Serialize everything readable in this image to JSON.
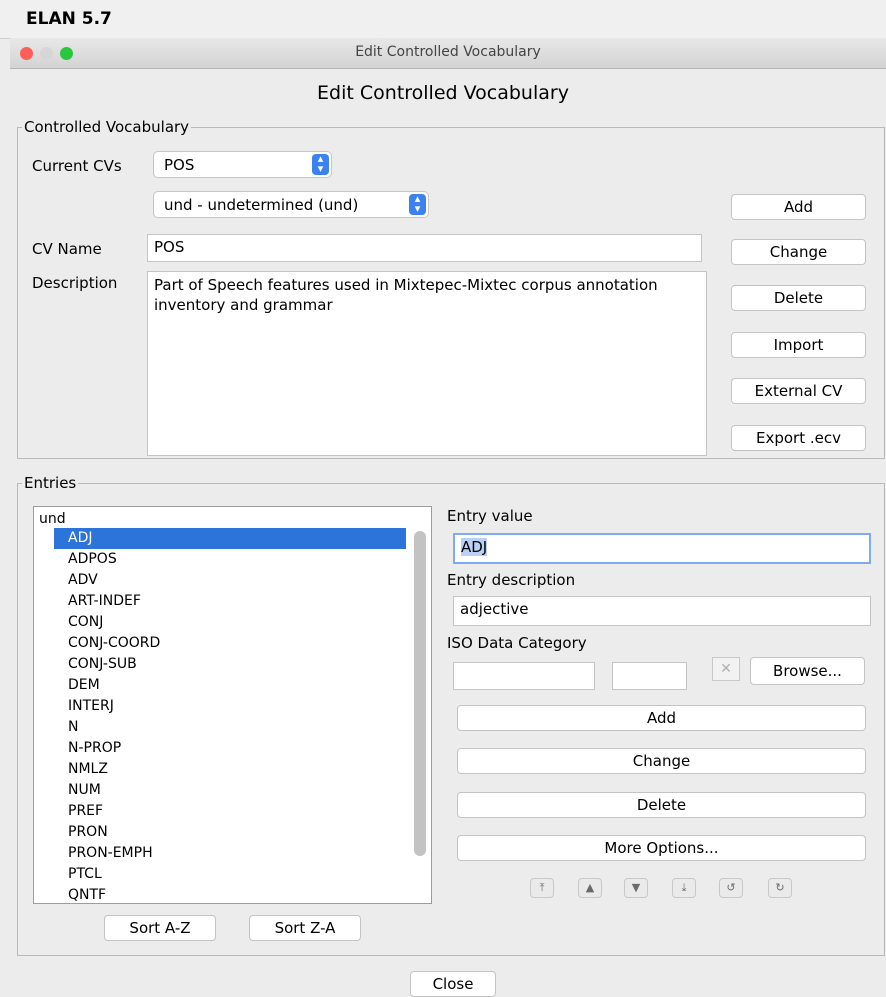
{
  "app": {
    "name": "ELAN 5.7"
  },
  "window": {
    "title": "Edit Controlled Vocabulary",
    "heading": "Edit Controlled Vocabulary"
  },
  "cv_section": {
    "legend": "Controlled Vocabulary",
    "current_cvs_label": "Current CVs",
    "current_cv_value": "POS",
    "language_value": "und - undetermined (und)",
    "cv_name_label": "CV Name",
    "cv_name_value": "POS",
    "description_label": "Description",
    "description_value": "Part of Speech features used in Mixtepec-Mixtec corpus annotation inventory and grammar",
    "buttons": {
      "add": "Add",
      "change": "Change",
      "delete": "Delete",
      "import": "Import",
      "external": "External CV",
      "export": "Export .ecv"
    }
  },
  "entries_section": {
    "legend": "Entries",
    "list_header": "und",
    "items": [
      "ADJ",
      "ADPOS",
      "ADV",
      "ART-INDEF",
      "CONJ",
      "CONJ-COORD",
      "CONJ-SUB",
      "DEM",
      "INTERJ",
      "N",
      "N-PROP",
      "NMLZ",
      "NUM",
      "PREF",
      "PRON",
      "PRON-EMPH",
      "PTCL",
      "QNTF"
    ],
    "selected_item": "ADJ",
    "sort_az": "Sort A-Z",
    "sort_za": "Sort Z-A",
    "entry_value_label": "Entry value",
    "entry_value": "ADJ",
    "entry_description_label": "Entry description",
    "entry_description": "adjective",
    "iso_label": "ISO Data Category",
    "browse": "Browse...",
    "add": "Add",
    "change": "Change",
    "delete": "Delete",
    "more_options": "More Options..."
  },
  "nav_icons": [
    "move-to-top-icon",
    "move-up-icon",
    "move-down-icon",
    "move-to-bottom-icon",
    "undo-icon",
    "redo-icon"
  ],
  "footer": {
    "close": "Close"
  },
  "colors": {
    "accent": "#3b82f0",
    "selection": "#2c74d9",
    "close_light": "#fc5f57",
    "minimize_light": "#d6d6d6",
    "zoom_light": "#29c63f"
  }
}
